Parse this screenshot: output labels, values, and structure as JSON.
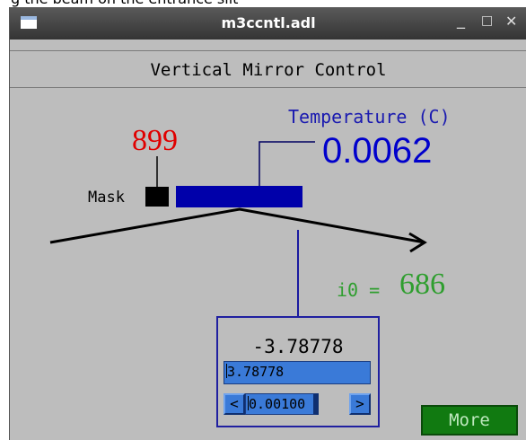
{
  "caption": "g the beam on the entrance slit",
  "window": {
    "title": "m3ccntl.adl",
    "minimize_glyph": "_",
    "maximize_glyph": "□",
    "close_glyph": "✕",
    "icon": "window-icon"
  },
  "header": {
    "title": "Vertical Mirror Control"
  },
  "temperature": {
    "label": "Temperature (C)",
    "value": "0.0062"
  },
  "mask": {
    "value": "899",
    "label": "Mask"
  },
  "i0": {
    "label": "i0 =",
    "value": "686"
  },
  "control": {
    "readback": "-3.78778",
    "setpoint": "3.78778",
    "tweak_left": "<",
    "tweak_value": "0.00100",
    "tweak_right": ">"
  },
  "more_button": {
    "label": "More"
  },
  "colors": {
    "background": "#bdbdbd",
    "temperature": "#0000cc",
    "mask_value": "#e00000",
    "i0": "#2e9e2e",
    "mirror_bar": "#0000aa",
    "more_button": "#117a11"
  }
}
